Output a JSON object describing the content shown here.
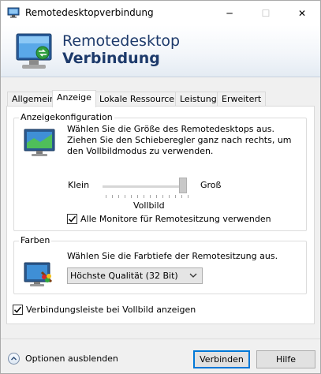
{
  "window": {
    "title": "Remotedesktopverbindung",
    "controls": {
      "minimize": "─",
      "maximize": "☐",
      "close": "✕"
    }
  },
  "banner": {
    "line1": "Remotedesktop",
    "line2": "Verbindung"
  },
  "tabs": [
    {
      "label": "Allgemein",
      "active": false
    },
    {
      "label": "Anzeige",
      "active": true
    },
    {
      "label": "Lokale Ressourcen",
      "active": false
    },
    {
      "label": "Leistung",
      "active": false
    },
    {
      "label": "Erweitert",
      "active": false
    }
  ],
  "display_config": {
    "group_title": "Anzeigekonfiguration",
    "description": "Wählen Sie die Größe des Remotedesktops aus. Ziehen Sie den Schieberegler ganz nach rechts, um den Vollbildmodus zu verwenden.",
    "slider_min_label": "Klein",
    "slider_max_label": "Groß",
    "slider_value_label": "Vollbild",
    "slider_level": 1.0,
    "all_monitors_label": "Alle Monitore für Remotesitzung verwenden",
    "all_monitors_checked": true
  },
  "colors_group": {
    "group_title": "Farben",
    "description": "Wählen Sie die Farbtiefe der Remotesitzung aus.",
    "selected": "Höchste Qualität (32 Bit)"
  },
  "connection_bar": {
    "label": "Verbindungsleiste bei Vollbild anzeigen",
    "checked": true
  },
  "footer": {
    "options_label": "Optionen ausblenden",
    "connect_label": "Verbinden",
    "help_label": "Hilfe"
  },
  "theme": {
    "accent": "#0078d7",
    "banner_text": "#1d3a6b"
  }
}
